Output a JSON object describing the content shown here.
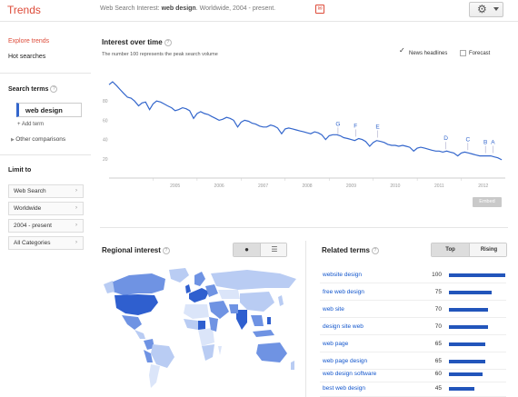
{
  "header": {
    "brand": "Trends",
    "query_prefix": "Web Search Interest: ",
    "query_term": "web design",
    "query_suffix": ". Worldwide, 2004 - present."
  },
  "sidebar": {
    "nav": [
      "Explore trends",
      "Hot searches"
    ],
    "search_terms_title": "Search terms",
    "term": "web design",
    "add_term": "+ Add term",
    "other_comparisons": "Other comparisons",
    "limit_to_title": "Limit to",
    "filters": [
      "Web Search",
      "Worldwide",
      "2004 - present",
      "All Categories"
    ]
  },
  "interest_over_time": {
    "title": "Interest over time",
    "subtitle": "The number 100 represents the peak search volume",
    "news_headlines_label": "News headlines",
    "news_headlines_checked": true,
    "forecast_label": "Forecast",
    "forecast_checked": false,
    "embed_label": "Embed"
  },
  "chart_data": {
    "type": "line",
    "title": "Interest over time",
    "xlabel": "",
    "ylabel": "",
    "y_ticks": [
      80,
      60,
      40,
      20
    ],
    "x_ticks": [
      "2005",
      "2006",
      "2007",
      "2008",
      "2009",
      "2010",
      "2011",
      "2012"
    ],
    "ylim": [
      0,
      100
    ],
    "xlim": [
      2004.0,
      2013.0
    ],
    "grid": false,
    "color": "#3366cc",
    "series": [
      {
        "values": [
          [
            2004.0,
            97
          ],
          [
            2004.08,
            100
          ],
          [
            2004.17,
            96
          ],
          [
            2004.25,
            92
          ],
          [
            2004.33,
            88
          ],
          [
            2004.42,
            84
          ],
          [
            2004.5,
            83
          ],
          [
            2004.58,
            80
          ],
          [
            2004.67,
            75
          ],
          [
            2004.75,
            78
          ],
          [
            2004.83,
            79
          ],
          [
            2004.92,
            71
          ],
          [
            2005.0,
            77
          ],
          [
            2005.08,
            80
          ],
          [
            2005.17,
            79
          ],
          [
            2005.25,
            77
          ],
          [
            2005.33,
            75
          ],
          [
            2005.42,
            73
          ],
          [
            2005.5,
            70
          ],
          [
            2005.58,
            71
          ],
          [
            2005.67,
            73
          ],
          [
            2005.75,
            72
          ],
          [
            2005.83,
            70
          ],
          [
            2005.92,
            62
          ],
          [
            2006.0,
            67
          ],
          [
            2006.08,
            69
          ],
          [
            2006.17,
            67
          ],
          [
            2006.25,
            66
          ],
          [
            2006.33,
            64
          ],
          [
            2006.42,
            62
          ],
          [
            2006.5,
            60
          ],
          [
            2006.58,
            61
          ],
          [
            2006.67,
            63
          ],
          [
            2006.75,
            62
          ],
          [
            2006.83,
            60
          ],
          [
            2006.92,
            53
          ],
          [
            2007.0,
            58
          ],
          [
            2007.08,
            60
          ],
          [
            2007.17,
            59
          ],
          [
            2007.25,
            57
          ],
          [
            2007.33,
            56
          ],
          [
            2007.42,
            54
          ],
          [
            2007.5,
            53
          ],
          [
            2007.58,
            53
          ],
          [
            2007.67,
            55
          ],
          [
            2007.75,
            54
          ],
          [
            2007.83,
            52
          ],
          [
            2007.92,
            46
          ],
          [
            2008.0,
            51
          ],
          [
            2008.08,
            52
          ],
          [
            2008.17,
            51
          ],
          [
            2008.25,
            50
          ],
          [
            2008.33,
            49
          ],
          [
            2008.42,
            48
          ],
          [
            2008.5,
            47
          ],
          [
            2008.58,
            46
          ],
          [
            2008.67,
            48
          ],
          [
            2008.75,
            47
          ],
          [
            2008.83,
            45
          ],
          [
            2008.92,
            40
          ],
          [
            2009.0,
            44
          ],
          [
            2009.08,
            45
          ],
          [
            2009.17,
            45
          ],
          [
            2009.25,
            44
          ],
          [
            2009.33,
            42
          ],
          [
            2009.42,
            41
          ],
          [
            2009.5,
            40
          ],
          [
            2009.58,
            39
          ],
          [
            2009.67,
            41
          ],
          [
            2009.75,
            40
          ],
          [
            2009.83,
            38
          ],
          [
            2009.92,
            33
          ],
          [
            2010.0,
            37
          ],
          [
            2010.08,
            39
          ],
          [
            2010.17,
            38
          ],
          [
            2010.25,
            37
          ],
          [
            2010.33,
            35
          ],
          [
            2010.42,
            34
          ],
          [
            2010.5,
            34
          ],
          [
            2010.58,
            33
          ],
          [
            2010.67,
            34
          ],
          [
            2010.75,
            33
          ],
          [
            2010.83,
            32
          ],
          [
            2010.92,
            28
          ],
          [
            2011.0,
            31
          ],
          [
            2011.08,
            32
          ],
          [
            2011.17,
            31
          ],
          [
            2011.25,
            30
          ],
          [
            2011.33,
            29
          ],
          [
            2011.42,
            28
          ],
          [
            2011.5,
            28
          ],
          [
            2011.58,
            27
          ],
          [
            2011.67,
            28
          ],
          [
            2011.75,
            27
          ],
          [
            2011.83,
            26
          ],
          [
            2011.92,
            23
          ],
          [
            2012.0,
            26
          ],
          [
            2012.08,
            27
          ],
          [
            2012.17,
            26
          ],
          [
            2012.25,
            25
          ],
          [
            2012.33,
            24
          ],
          [
            2012.42,
            23
          ],
          [
            2012.5,
            23
          ],
          [
            2012.58,
            23
          ],
          [
            2012.67,
            23
          ],
          [
            2012.75,
            22
          ],
          [
            2012.83,
            21
          ],
          [
            2012.92,
            19
          ]
        ]
      }
    ],
    "annotations": [
      {
        "label": "G",
        "x": 2009.2,
        "y": 45
      },
      {
        "label": "F",
        "x": 2009.6,
        "y": 43
      },
      {
        "label": "E",
        "x": 2010.1,
        "y": 42
      },
      {
        "label": "D",
        "x": 2011.65,
        "y": 30
      },
      {
        "label": "C",
        "x": 2012.15,
        "y": 29
      },
      {
        "label": "B",
        "x": 2012.55,
        "y": 26
      },
      {
        "label": "A",
        "x": 2012.72,
        "y": 26
      }
    ]
  },
  "regional_interest": {
    "title": "Regional interest",
    "view_buttons": [
      "globe-icon",
      "list-icon"
    ],
    "map_colors": {
      "dark": "#2f5fcf",
      "mid": "#6f93e3",
      "light": "#b9ccf3",
      "pale": "#dbe5f9"
    }
  },
  "related_terms": {
    "title": "Related terms",
    "tabs": [
      "Top",
      "Rising"
    ],
    "active_tab": "Top",
    "items": [
      {
        "term": "website design",
        "value": 100
      },
      {
        "term": "free web design",
        "value": 75
      },
      {
        "term": "web site",
        "value": 70
      },
      {
        "term": "design site web",
        "value": 70
      },
      {
        "term": "web page",
        "value": 65
      },
      {
        "term": "web page design",
        "value": 65
      },
      {
        "term": "web design software",
        "value": 60
      },
      {
        "term": "best web design",
        "value": 45
      }
    ]
  }
}
